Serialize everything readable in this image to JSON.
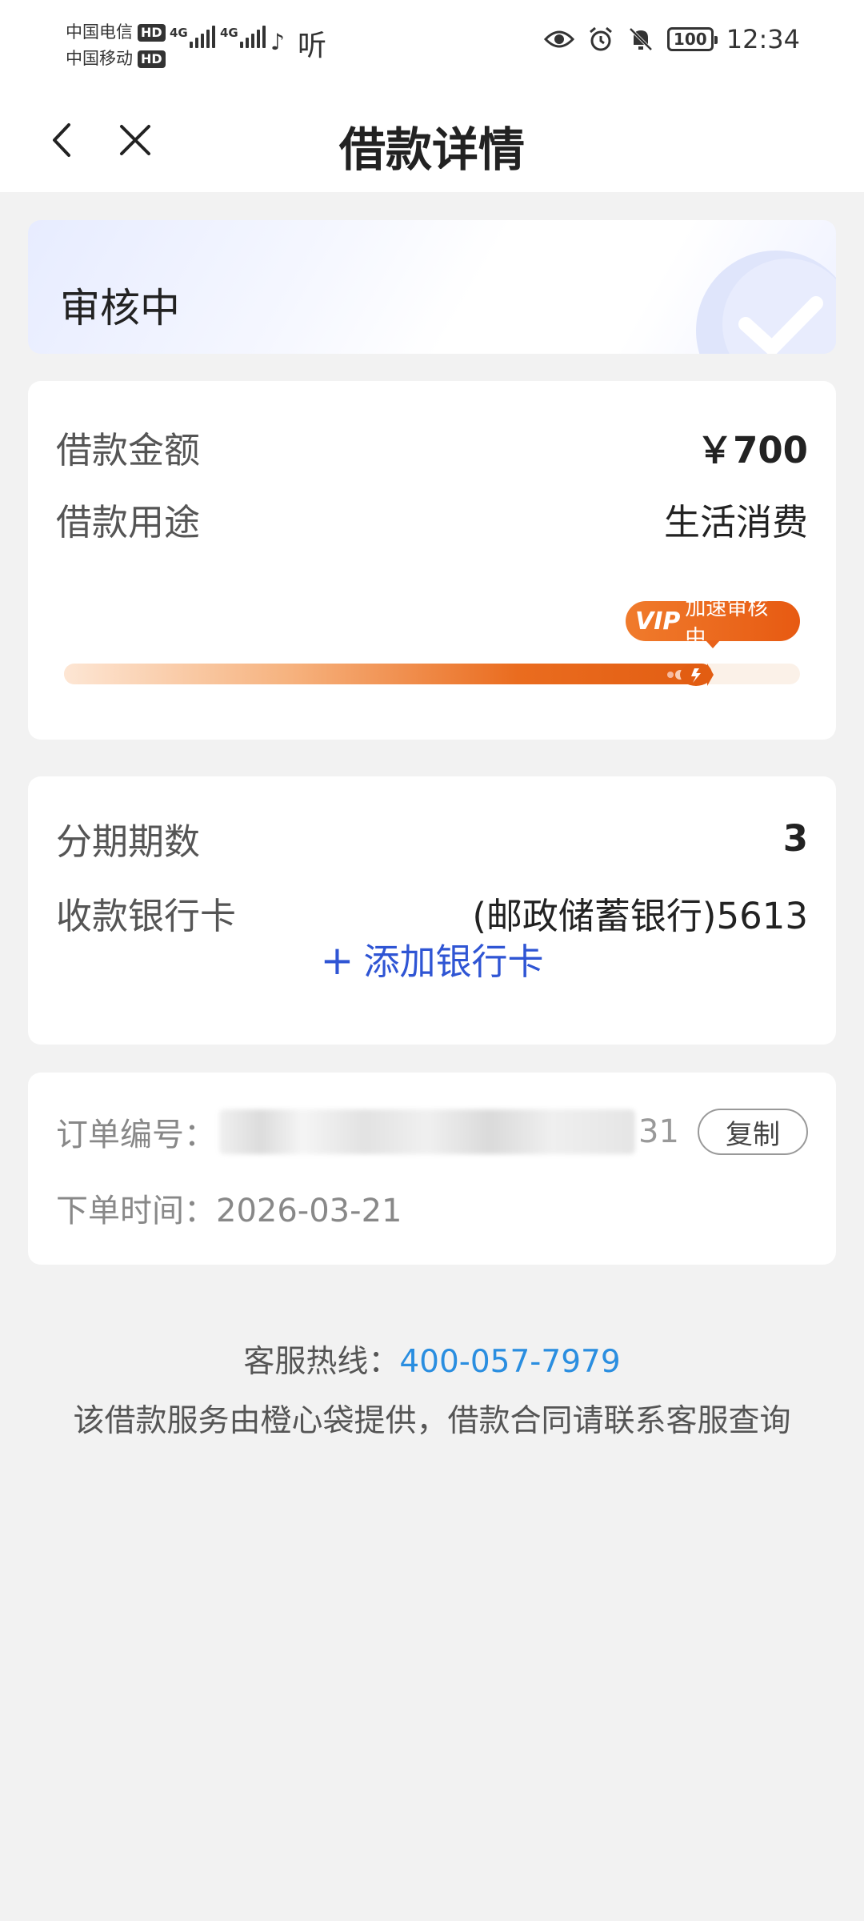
{
  "status_bar": {
    "carrier1": "中国电信",
    "carrier2": "中国移动",
    "hd": "HD",
    "net1": "4G",
    "net2": "4G",
    "misc": "听",
    "battery": "100",
    "time": "12:34"
  },
  "header": {
    "title": "借款详情"
  },
  "status_card": {
    "status": "审核中"
  },
  "loan_info": {
    "amount_label": "借款金额",
    "amount_value": "￥700",
    "purpose_label": "借款用途",
    "purpose_value": "生活消费",
    "progress_fraction": 0.88,
    "vip_text": "VIP",
    "badge_text": "加速审核中"
  },
  "installment": {
    "periods_label": "分期期数",
    "periods_value": "3",
    "card_label": "收款银行卡",
    "card_value": "(邮政储蓄银行)5613",
    "add_card_label": "添加银行卡",
    "add_card_icon": "plus-icon"
  },
  "order": {
    "order_no_label": "订单编号：",
    "order_no_tail": "31",
    "copy_label": "复制",
    "time_label": "下单时间：",
    "time_value": "2026-03-21"
  },
  "footer": {
    "hotline_label": "客服热线：",
    "hotline_number": "400-057-7979",
    "note": "该借款服务由橙心袋提供，借款合同请联系客服查询"
  },
  "colors": {
    "accent_blue": "#2f55d4",
    "hotline_blue": "#2a8ee0",
    "progress_orange": "#e25d12",
    "background": "#f2f2f2"
  }
}
